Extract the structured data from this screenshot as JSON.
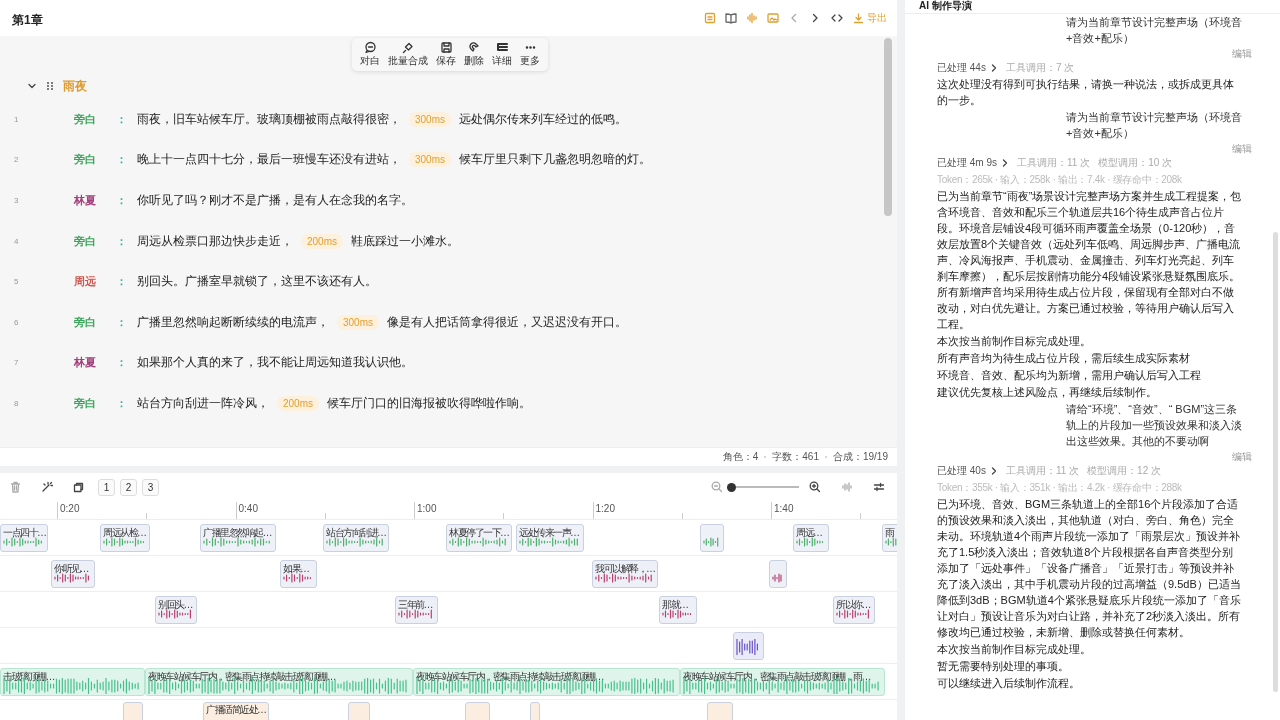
{
  "editor": {
    "chapter_title": "第1章",
    "export_label": "导出",
    "floating_toolbar": [
      {
        "label": "对白"
      },
      {
        "label": "批量合成"
      },
      {
        "label": "保存"
      },
      {
        "label": "删除"
      },
      {
        "label": "详细"
      },
      {
        "label": "更多"
      }
    ],
    "section": {
      "title": "雨夜",
      "expanded": true
    },
    "lines": [
      {
        "number": "1",
        "speaker": "旁白",
        "color": "#3aa55a",
        "separator": "：",
        "text": "雨夜，旧车站候车厅。玻璃顶棚被雨点敲得很密，",
        "pause": "300ms",
        "text_after": "远处偶尔传来列车经过的低鸣。"
      },
      {
        "number": "2",
        "speaker": "旁白",
        "color": "#3aa55a",
        "separator": "：",
        "text": "晚上十一点四十七分，最后一班慢车还没有进站，",
        "pause": "300ms",
        "text_after": "候车厅里只剩下几盏忽明忽暗的灯。"
      },
      {
        "number": "3",
        "speaker": "林夏",
        "color": "#a3407c",
        "separator": "：",
        "text": "你听见了吗？刚才不是广播，是有人在念我的名字。"
      },
      {
        "number": "4",
        "speaker": "旁白",
        "color": "#3aa55a",
        "separator": "：",
        "text": "周远从检票口那边快步走近，",
        "pause": "200ms",
        "text_after": "鞋底踩过一小滩水。"
      },
      {
        "number": "5",
        "speaker": "周远",
        "color": "#d0584e",
        "separator": "：",
        "text": "别回头。广播室早就锁了，这里不该还有人。"
      },
      {
        "number": "6",
        "speaker": "旁白",
        "color": "#3aa55a",
        "separator": "：",
        "text": "广播里忽然响起断断续续的电流声，",
        "pause": "300ms",
        "text_after": "像是有人把话筒拿得很近，又迟迟没有开口。"
      },
      {
        "number": "7",
        "speaker": "林夏",
        "color": "#a3407c",
        "separator": "：",
        "text": "如果那个人真的来了，我不能让周远知道我认识他。"
      },
      {
        "number": "8",
        "speaker": "旁白",
        "color": "#3aa55a",
        "separator": "：",
        "text": "站台方向刮进一阵冷风，",
        "pause": "200ms",
        "text_after": "候车厅门口的旧海报被吹得哗啦作响。"
      }
    ],
    "stats": [
      "角色：4",
      "字数：461",
      "合成：19/19"
    ]
  },
  "timeline": {
    "layer_buttons": [
      {
        "label": "1"
      },
      {
        "label": "2"
      },
      {
        "label": "3"
      }
    ],
    "zoom": {
      "level": 0.0
    },
    "ticks": [
      "0:20",
      "0:40",
      "1:00",
      "1:20",
      "1:40"
    ],
    "tracks": [
      {
        "kind": "narration",
        "clips": [
          {
            "label": "一点四十…"
          },
          {
            "label": "周远从检…"
          },
          {
            "label": "广播里忽然响起…"
          },
          {
            "label": "站台方向刮进…"
          },
          {
            "label": "林夏停了一下…"
          },
          {
            "label": "远处传来一声…"
          },
          {
            "label": "周远…"
          },
          {
            "label": "雨"
          }
        ]
      },
      {
        "kind": "voice",
        "clips": [
          {
            "label": "你听见…"
          },
          {
            "label": "如果…"
          },
          {
            "label": "我可以解释，…"
          }
        ]
      },
      {
        "kind": "voice",
        "clips": [
          {
            "label": "别回头…"
          },
          {
            "label": "三年前…"
          },
          {
            "label": "那就…"
          },
          {
            "label": "所以你…"
          }
        ]
      },
      {
        "kind": "music"
      },
      {
        "kind": "ambience",
        "clips": [
          {
            "label": "击玻璃顶棚…"
          },
          {
            "label": "夜晚车站候车厅内，密集雨点持续敲击玻璃顶棚…"
          },
          {
            "label": "夜晚车站候车厅内，密集雨点持续敲击玻璃顶棚…"
          },
          {
            "label": "夜晚车站候车厅内，密集雨点敲击玻璃顶棚，雨…"
          }
        ]
      },
      {
        "kind": "effects",
        "clips": [
          {
            "label": "广播适简近处…"
          }
        ]
      }
    ]
  },
  "assistant": {
    "title": "AI 制作导演",
    "messages": [
      {
        "kind": "user",
        "text": "请为当前章节设计完整声场（环境音+音效+配乐）",
        "edit_label": "编辑"
      },
      {
        "kind": "reply",
        "duration": "已处理 44s",
        "stats": [
          "工具调用：7 次"
        ],
        "paragraphs": [
          "这次处理没有得到可执行结果，请换一种说法，或拆成更具体的一步。"
        ]
      },
      {
        "kind": "user",
        "text": "请为当前章节设计完整声场（环境音+音效+配乐）",
        "edit_label": "编辑"
      },
      {
        "kind": "reply",
        "duration": "已处理 4m 9s",
        "stats": [
          "工具调用：11 次",
          "模型调用：10 次"
        ],
        "token": "Token：265k · 输入：258k · 输出：7.4k · 缓存命中：208k",
        "paragraphs": [
          "已为当前章节“雨夜”场景设计完整声场方案并生成工程提案，包含环境音、音效和配乐三个轨道层共16个待生成声音占位片段。环境音层铺设4段可循环雨声覆盖全场景（0-120秒），音效层放置8个关键音效（远处列车低鸣、周远脚步声、广播电流声、冷风海报声、手机震动、金属撞击、列车灯光亮起、列车刹车摩擦），配乐层按剧情功能分4段铺设紧张悬疑氛围底乐。所有新增声音均采用待生成占位片段，保留现有全部对白不做改动，对白优先避让。方案已通过校验，等待用户确认后写入工程。",
          "本次按当前制作目标完成处理。",
          "所有声音均为待生成占位片段，需后续生成实际素材",
          "环境音、音效、配乐均为新增，需用户确认后写入工程",
          "建议优先复核上述风险点，再继续后续制作。"
        ]
      },
      {
        "kind": "user",
        "text": "请给“环境”、“音效”、“ BGM”这三条轨上的片段加一些预设效果和淡入淡出这些效果。其他的不要动啊",
        "edit_label": "编辑"
      },
      {
        "kind": "reply",
        "duration": "已处理 40s",
        "stats": [
          "工具调用：11 次",
          "模型调用：12 次"
        ],
        "token": "Token：355k · 输入：351k · 输出：4.2k · 缓存命中：288k",
        "paragraphs": [
          "已为环境、音效、BGM三条轨道上的全部16个片段添加了合适的预设效果和淡入淡出，其他轨道（对白、旁白、角色）完全未动。环境轨道4个雨声片段统一添加了「雨景层次」预设并补充了1.5秒淡入淡出；音效轨道8个片段根据各自声音类型分别添加了「远处事件」「设备广播音」「近景打击」等预设并补充了淡入淡出，其中手机震动片段的过高增益（9.5dB）已适当降低到3dB；BGM轨道4个紧张悬疑底乐片段统一添加了「音乐让对白」预设让音乐为对白让路，并补充了2秒淡入淡出。所有修改均已通过校验，未新增、删除或替换任何素材。",
          "本次按当前制作目标完成处理。",
          "暂无需要特别处理的事项。",
          "可以继续进入后续制作流程。"
        ]
      }
    ]
  }
}
